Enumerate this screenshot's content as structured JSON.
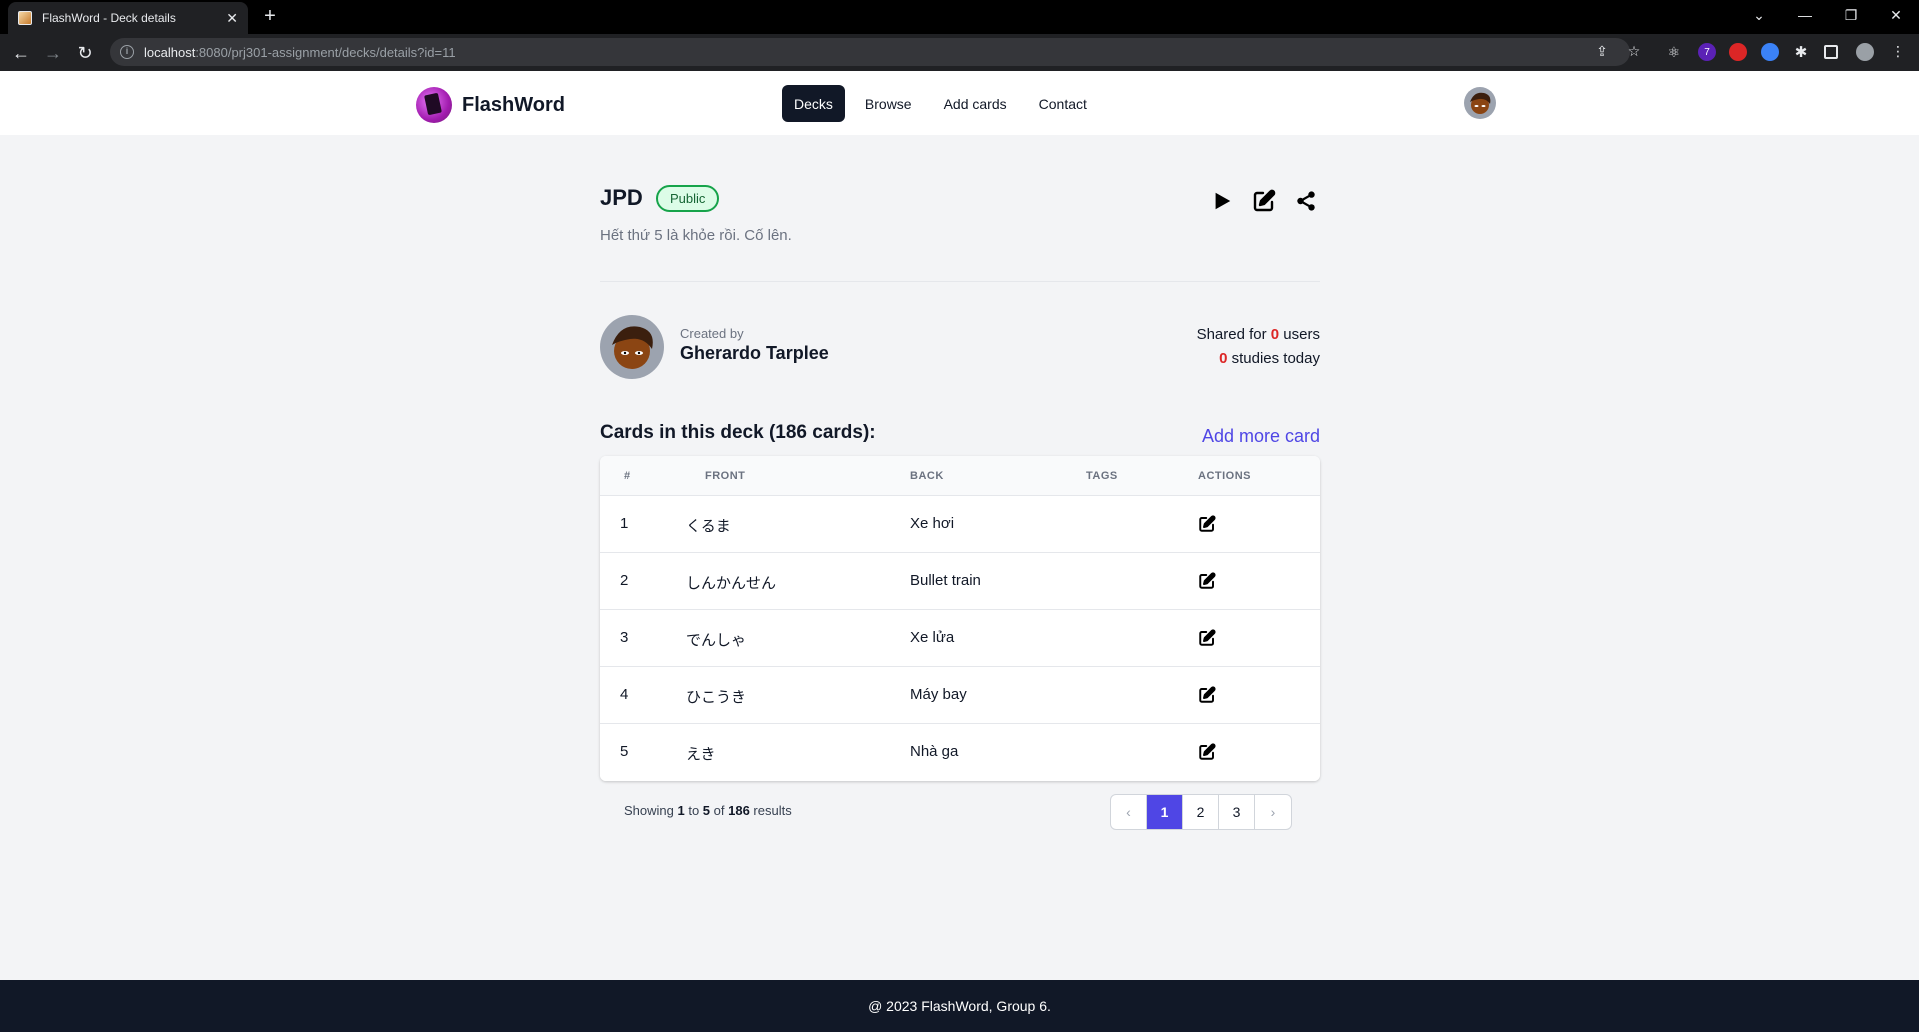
{
  "browser": {
    "tab_title": "FlashWord - Deck details",
    "tab_close": "✕",
    "new_tab": "+",
    "url_host": "localhost",
    "url_path": ":8080/prj301-assignment/decks/details?id=11",
    "extension_badge": "7"
  },
  "site": {
    "brand": "FlashWord",
    "nav": [
      {
        "label": "Decks",
        "active": true
      },
      {
        "label": "Browse",
        "active": false
      },
      {
        "label": "Add cards",
        "active": false
      },
      {
        "label": "Contact",
        "active": false
      }
    ]
  },
  "deck": {
    "title": "JPD",
    "visibility": "Public",
    "description": "Hết thứ 5 là khỏe rồi. Cố lên.",
    "created_by_label": "Created by",
    "creator_name": "Gherardo Tarplee",
    "shared_prefix": "Shared for ",
    "shared_count": "0",
    "shared_suffix": " users",
    "studies_count": "0",
    "studies_suffix": " studies today"
  },
  "cards": {
    "title": "Cards in this deck (186 cards):",
    "add_more": "Add more card",
    "columns": [
      "#",
      "FRONT",
      "BACK",
      "TAGS",
      "ACTIONS"
    ],
    "rows": [
      {
        "num": "1",
        "front": "くるま",
        "back": "Xe hơi",
        "tags": ""
      },
      {
        "num": "2",
        "front": "しんかんせん",
        "back": "Bullet train",
        "tags": ""
      },
      {
        "num": "3",
        "front": "でんしゃ",
        "back": "Xe lửa",
        "tags": ""
      },
      {
        "num": "4",
        "front": "ひこうき",
        "back": "Máy bay",
        "tags": ""
      },
      {
        "num": "5",
        "front": "えき",
        "back": "Nhà ga",
        "tags": ""
      }
    ]
  },
  "pagination": {
    "showing": "Showing ",
    "from": "1",
    "to_word": " to ",
    "to": "5",
    "of_word": " of ",
    "total": "186",
    "results": " results",
    "pages": [
      "1",
      "2",
      "3"
    ],
    "current": "1",
    "prev": "‹",
    "next": "›"
  },
  "footer": {
    "text": "@ 2023 FlashWord, Group 6."
  },
  "colors": {
    "accent": "#4f46e5",
    "dark": "#111827",
    "public_badge": "#16a34a",
    "highlight_red": "#dc2626"
  },
  "icons": {
    "play": "play-icon",
    "edit": "edit-icon",
    "share": "share-icon"
  }
}
